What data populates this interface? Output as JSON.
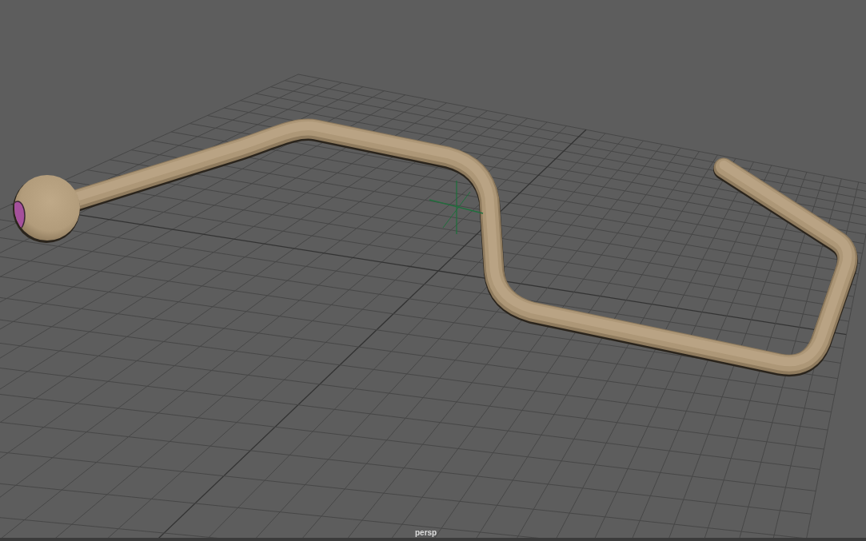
{
  "viewport": {
    "camera_label": "persp"
  }
}
